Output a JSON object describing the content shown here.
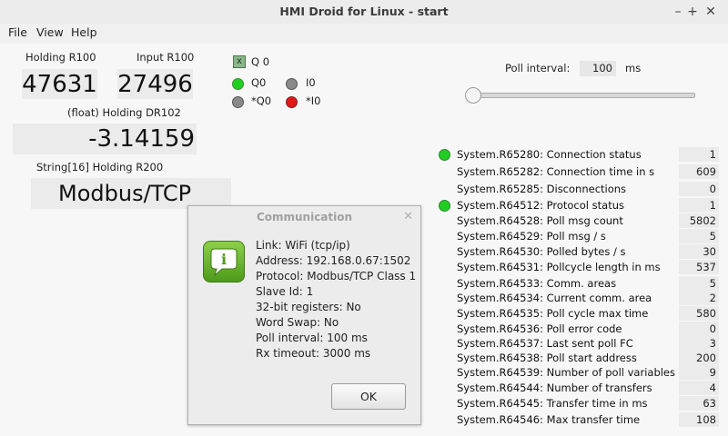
{
  "window": {
    "title": "HMI Droid for Linux - start",
    "minimize": "–",
    "maximize": "+",
    "close": "✕"
  },
  "menu": [
    "File",
    "View",
    "Help"
  ],
  "registers": {
    "holding_label": "Holding R100",
    "holding_value": "47631",
    "input_label": "Input R100",
    "input_value": "27496",
    "float_label": "(float) Holding DR102",
    "float_value": "-3.14159",
    "string_label": "String[16] Holding R200",
    "string_value": "Modbus/TCP"
  },
  "io": {
    "q0_check_label": "Q 0",
    "q0": "Q0",
    "q0n": "*Q0",
    "i0": "I0",
    "i0n": "*I0",
    "check_mark": "x"
  },
  "poll": {
    "label": "Poll interval:",
    "value": "100",
    "unit": "ms"
  },
  "system_rows": [
    {
      "name": "System.R65280: Connection status",
      "value": "1",
      "led": true
    },
    {
      "name": "System.R65282: Connection time in s",
      "value": "609",
      "led": false
    },
    {
      "name": "System.R65285: Disconnections",
      "value": "0",
      "led": false
    },
    {
      "name": "System.R64512: Protocol status",
      "value": "1",
      "led": true
    },
    {
      "name": "System.R64528: Poll msg count",
      "value": "5802",
      "led": false
    },
    {
      "name": "System.R64529: Poll msg / s",
      "value": "5",
      "led": false
    },
    {
      "name": "System.R64530: Polled bytes / s",
      "value": "30",
      "led": false
    },
    {
      "name": "System.R64531: Pollcycle length in ms",
      "value": "537",
      "led": false
    },
    {
      "name": "System.R64533: Comm. areas",
      "value": "5",
      "led": false
    },
    {
      "name": "System.R64534: Current comm. area",
      "value": "2",
      "led": false
    },
    {
      "name": "System.R64535: Poll cycle max time",
      "value": "580",
      "led": false
    },
    {
      "name": "System.R64536: Poll error code",
      "value": "0",
      "led": false
    },
    {
      "name": "System.R64537: Last sent poll FC",
      "value": "3",
      "led": false
    },
    {
      "name": "System.R64538: Poll start address",
      "value": "200",
      "led": false
    },
    {
      "name": "System.R64539: Number of poll variables",
      "value": "9",
      "led": false
    },
    {
      "name": "System.R64544: Number of transfers",
      "value": "4",
      "led": false
    },
    {
      "name": "System.R64545: Transfer time in ms",
      "value": "63",
      "led": false
    },
    {
      "name": "System.R64546: Max transfer time",
      "value": "108",
      "led": false
    }
  ],
  "dialog": {
    "title": "Communication",
    "close": "✕",
    "icon_glyph": "i",
    "lines": [
      "Link: WiFi (tcp/ip)",
      "Address: 192.168.0.67:1502",
      "Protocol: Modbus/TCP Class 1",
      "Slave Id: 1",
      "32-bit registers: No",
      "Word Swap: No",
      "Poll interval: 100 ms",
      "Rx timeout: 3000 ms"
    ],
    "ok": "OK"
  },
  "colors": {
    "led_on": "#1ed11e",
    "led_off": "#8a8a8a",
    "led_alarm": "#e01818",
    "info_icon": "#6cb52e"
  }
}
